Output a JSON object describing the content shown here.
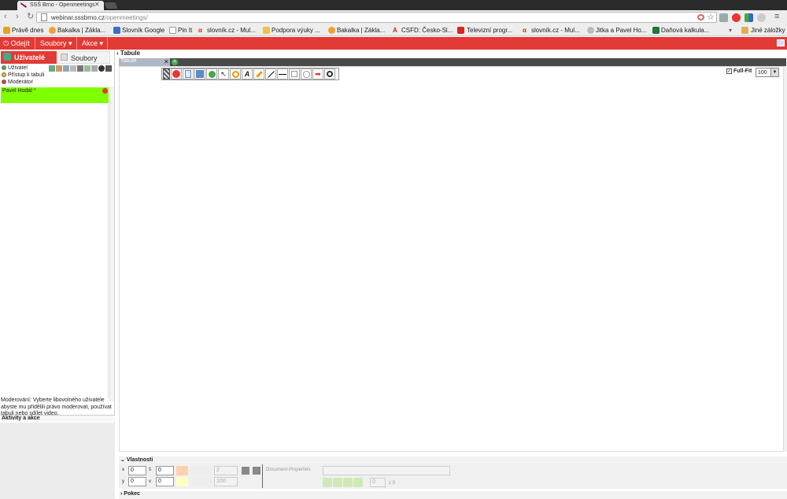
{
  "browser": {
    "tab_title": "SSŠ Brno - Openmeetings",
    "url_host": "webinar.sssbrno.cz",
    "url_path": "/openmeetings/",
    "bookmarks": [
      "Právě dnes",
      "Bakalka | Zákla...",
      "Slovník Google",
      "Pin It",
      "slovník.cz - Mul...",
      "Podpora výuky ...",
      "Bakalka | Zákla...",
      "CSFD: Česko-Sl...",
      "Televizní progr...",
      "slovník.cz - Mul...",
      "Jitka a Pavel Ho...",
      "Daňová kalkula..."
    ],
    "other_bookmarks": "Jiné záložky"
  },
  "appbar": {
    "logout": "Odejít",
    "files": "Soubory",
    "actions": "Akce"
  },
  "left": {
    "tab_users": "Uživatelé",
    "tab_files": "Soubory",
    "legend": [
      "Uživatel",
      "Přístup k tabuli",
      "Moderátor"
    ],
    "users": [
      "Pavel Hodál *"
    ],
    "moderation_note": "Moderování: Vyberte libovolného uživatele abyste mu přidělili právo moderovat, používat tabuli nebo sdílet video.",
    "activities": "Aktivity a akce"
  },
  "whiteboard": {
    "label": "Tabule",
    "tab": "Tabule",
    "fullfit": "Full-Fit",
    "zoom": "100"
  },
  "props": {
    "header": "Vlastnosti",
    "x_label": "x",
    "y_label": "y",
    "w_label": "š",
    "h_label": "v",
    "x": "0",
    "y": "0",
    "w": "0",
    "h": "0",
    "line_width": "2",
    "opacity": "100",
    "doc_props": "Document Properties",
    "page_of": "z 0",
    "page_cur": "0"
  },
  "pokec": "Pokec",
  "colors": {
    "accent": "#e23a35",
    "user_highlight": "#80ff00"
  }
}
